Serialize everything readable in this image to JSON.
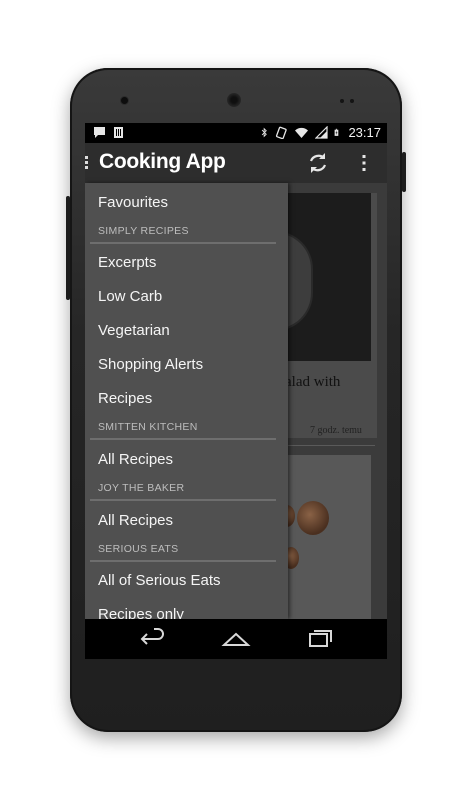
{
  "status_bar": {
    "left_icons": [
      "chat-notification-icon",
      "sim-card-icon"
    ],
    "right_icons": [
      "bluetooth-icon",
      "vibrate-icon",
      "wifi-icon",
      "signal-icon",
      "battery-charging-icon"
    ],
    "time": "23:17"
  },
  "action_bar": {
    "title": "Cooking App",
    "refresh_icon": "refresh-icon",
    "overflow_icon": "overflow-menu-icon"
  },
  "drawer": {
    "favourites": "Favourites",
    "sections": [
      {
        "header": "SIMPLY RECIPES",
        "items": [
          "Excerpts",
          "Low Carb",
          "Vegetarian",
          "Shopping Alerts",
          "Recipes"
        ]
      },
      {
        "header": "SMITTEN KITCHEN",
        "items": [
          "All Recipes"
        ]
      },
      {
        "header": "JOY THE BAKER",
        "items": [
          "All Recipes"
        ]
      },
      {
        "header": "SERIOUS EATS",
        "items": [
          "All of Serious Eats",
          "Recipes only"
        ]
      }
    ]
  },
  "feed": {
    "card_title": "alad with",
    "card_time": "7 godz. temu"
  },
  "nav_bar": {
    "back_icon": "back-icon",
    "home_icon": "home-icon",
    "recents_icon": "recent-apps-icon"
  },
  "colors": {
    "drawer_bg": "#505050",
    "action_bar_bg": "#2d2d2d",
    "status_bar_bg": "#000000",
    "divider": "#6e6e6e",
    "header_text": "#bdbdbd",
    "item_text": "#f5f5f5"
  }
}
